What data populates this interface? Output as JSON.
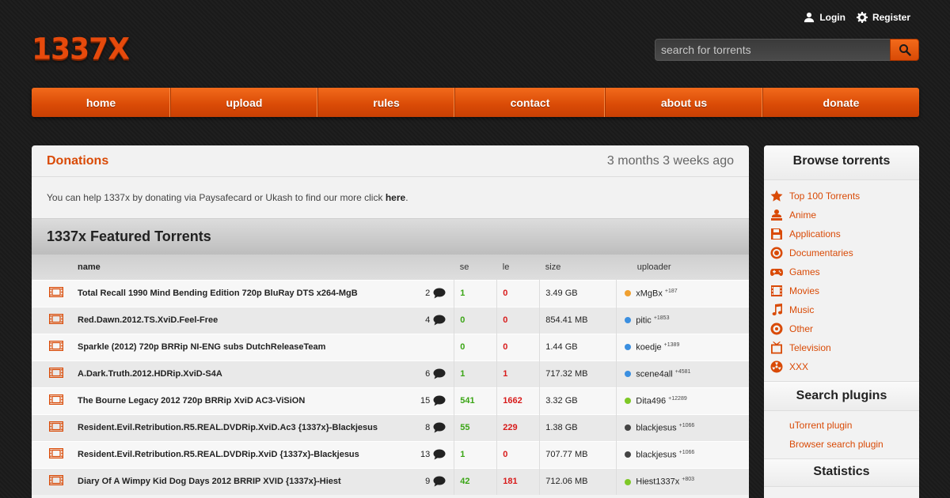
{
  "header": {
    "logo": "1337X",
    "login": "Login",
    "register": "Register",
    "search_placeholder": "search for torrents"
  },
  "nav": [
    {
      "label": "home"
    },
    {
      "label": "upload"
    },
    {
      "label": "rules"
    },
    {
      "label": "contact"
    },
    {
      "label": "about us"
    },
    {
      "label": "donate"
    }
  ],
  "donations": {
    "title": "Donations",
    "time": "3 months 3 weeks ago",
    "text": "You can help 1337x by donating via Paysafecard or Ukash to find our more click ",
    "link": "here",
    "end": "."
  },
  "featured": {
    "title": "1337x Featured Torrents",
    "columns": {
      "name": "name",
      "se": "se",
      "le": "le",
      "size": "size",
      "uploader": "uploader"
    },
    "rows": [
      {
        "name": "Total Recall 1990 Mind Bending Edition 720p BluRay DTS x264-MgB",
        "comments": "2",
        "se": "1",
        "le": "0",
        "size": "3.49 GB",
        "uploader": "xMgBx",
        "rep": "+187",
        "dot": "#f0a030"
      },
      {
        "name": "Red.Dawn.2012.TS.XviD.Feel-Free",
        "comments": "4",
        "se": "0",
        "le": "0",
        "size": "854.41 MB",
        "uploader": "pitic",
        "rep": "+1853",
        "dot": "#3b8fe0"
      },
      {
        "name": "Sparkle (2012) 720p BRRip NI-ENG subs DutchReleaseTeam",
        "comments": "",
        "se": "0",
        "le": "0",
        "size": "1.44 GB",
        "uploader": "koedje",
        "rep": "+1389",
        "dot": "#3b8fe0"
      },
      {
        "name": "A.Dark.Truth.2012.HDRip.XviD-S4A",
        "comments": "6",
        "se": "1",
        "le": "1",
        "size": "717.32 MB",
        "uploader": "scene4all",
        "rep": "+4581",
        "dot": "#3b8fe0"
      },
      {
        "name": "The Bourne Legacy 2012 720p BRRip XviD AC3-ViSiON",
        "comments": "15",
        "se": "541",
        "le": "1662",
        "size": "3.32 GB",
        "uploader": "Dita496",
        "rep": "+12289",
        "dot": "#7ec827"
      },
      {
        "name": "Resident.Evil.Retribution.R5.REAL.DVDRip.XviD.Ac3 {1337x}-Blackjesus",
        "comments": "8",
        "se": "55",
        "le": "229",
        "size": "1.38 GB",
        "uploader": "blackjesus",
        "rep": "+1066",
        "dot": "#444444"
      },
      {
        "name": "Resident.Evil.Retribution.R5.REAL.DVDRip.XviD {1337x}-Blackjesus",
        "comments": "13",
        "se": "1",
        "le": "0",
        "size": "707.77 MB",
        "uploader": "blackjesus",
        "rep": "+1066",
        "dot": "#444444"
      },
      {
        "name": "Diary Of A Wimpy Kid Dog Days 2012 BRRIP XVID {1337x}-Hiest",
        "comments": "9",
        "se": "42",
        "le": "181",
        "size": "712.06 MB",
        "uploader": "Hiest1337x",
        "rep": "+803",
        "dot": "#7ec827"
      }
    ]
  },
  "sidebar": {
    "browse_title": "Browse torrents",
    "browse": [
      {
        "label": "Top 100 Torrents",
        "icon": "star-icon"
      },
      {
        "label": "Anime",
        "icon": "anime-icon"
      },
      {
        "label": "Applications",
        "icon": "floppy-icon"
      },
      {
        "label": "Documentaries",
        "icon": "target-icon"
      },
      {
        "label": "Games",
        "icon": "gamepad-icon"
      },
      {
        "label": "Movies",
        "icon": "film-icon"
      },
      {
        "label": "Music",
        "icon": "music-note-icon"
      },
      {
        "label": "Other",
        "icon": "circle-icon"
      },
      {
        "label": "Television",
        "icon": "tv-icon"
      },
      {
        "label": "XXX",
        "icon": "radiation-icon"
      }
    ],
    "plugins_title": "Search plugins",
    "plugins": [
      {
        "label": "uTorrent plugin"
      },
      {
        "label": "Browser search plugin"
      }
    ],
    "stats_title": "Statistics"
  },
  "colors": {
    "accent": "#d94a06",
    "seeders": "#3aa515",
    "leechers": "#d81b1b"
  }
}
